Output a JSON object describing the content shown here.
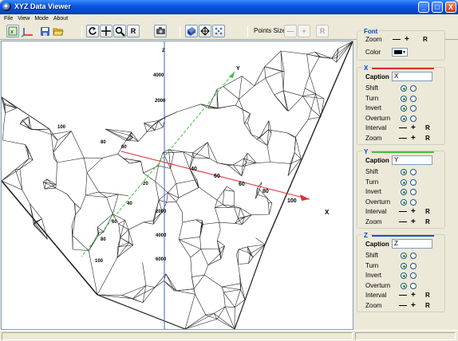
{
  "window": {
    "title": "XYZ Data Viewer",
    "min": "_",
    "max": "□",
    "close": "X"
  },
  "menu": [
    "File",
    "View",
    "Mode",
    "About"
  ],
  "toolbar": {
    "reset": "R",
    "points_size_label": "Points Size",
    "minus": "—",
    "plus": "+",
    "points_reset": "R"
  },
  "font": {
    "title": "Font",
    "zoom_label": "Zoom",
    "minus": "—",
    "plus": "+",
    "reset": "R",
    "color_label": "Color",
    "color_value": "#000000"
  },
  "axes": [
    {
      "title": "X",
      "color": "#e03030",
      "caption_label": "Caption",
      "caption": "X",
      "rows": [
        "Shift",
        "Turn",
        "Invert",
        "Overturn"
      ],
      "interval_label": "Interval",
      "zoom_label": "Zoom",
      "minus": "—",
      "plus": "+",
      "reset": "R"
    },
    {
      "title": "Y",
      "color": "#40c040",
      "caption_label": "Caption",
      "caption": "Y",
      "rows": [
        "Shift",
        "Turn",
        "Invert",
        "Overturn"
      ],
      "interval_label": "Interval",
      "zoom_label": "Zoom",
      "minus": "—",
      "plus": "+",
      "reset": "R"
    },
    {
      "title": "Z",
      "color": "#2050c0",
      "caption_label": "Caption",
      "caption": "Z",
      "rows": [
        "Shift",
        "Turn",
        "Invert",
        "Overturn"
      ],
      "interval_label": "Interval",
      "zoom_label": "Zoom",
      "minus": "—",
      "plus": "+",
      "reset": "R"
    }
  ],
  "scene": {
    "x_ticks": [
      "40",
      "60",
      "60",
      "80",
      "100"
    ],
    "x_label": "X",
    "y_ticks": [
      "20",
      "40",
      "60",
      "80",
      "100"
    ],
    "y_label": "Y",
    "z_ticks": [
      "4000",
      "2000",
      "2000",
      "4000",
      "6000"
    ],
    "z_label": "Z",
    "left_ticks": [
      "100",
      "80",
      "60"
    ]
  }
}
